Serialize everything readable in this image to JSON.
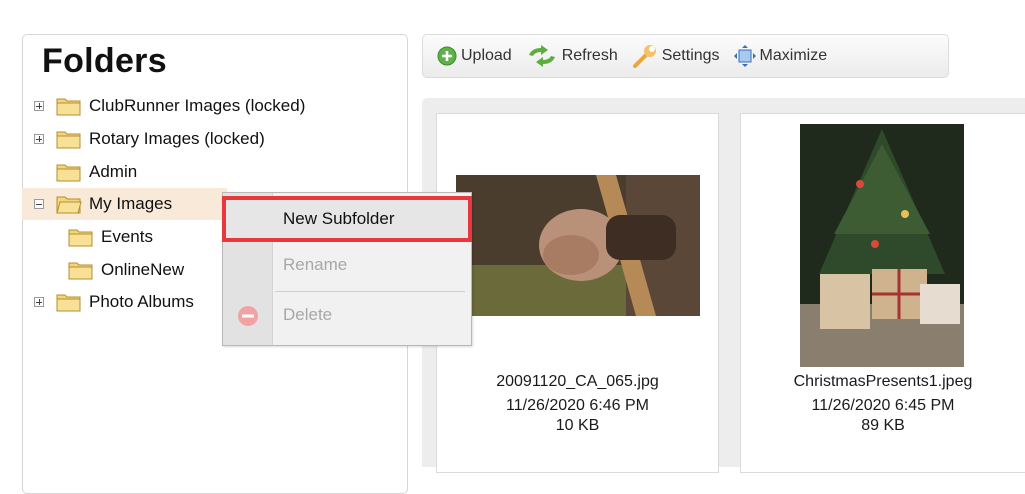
{
  "folders_panel": {
    "title": "Folders",
    "tree": [
      {
        "label": "ClubRunner Images (locked)"
      },
      {
        "label": "Rotary Images (locked)"
      },
      {
        "label": "Admin"
      },
      {
        "label": "My Images"
      },
      {
        "label": "Events"
      },
      {
        "label": "OnlineNew"
      },
      {
        "label": "Photo Albums"
      }
    ]
  },
  "toolbar": {
    "upload": "Upload",
    "refresh": "Refresh",
    "settings": "Settings",
    "maximize": "Maximize"
  },
  "files": [
    {
      "name": "20091120_CA_065.jpg",
      "date": "11/26/2020 6:46 PM",
      "size": "10 KB"
    },
    {
      "name": "ChristmasPresents1.jpeg",
      "date": "11/26/2020 6:45 PM",
      "size": "89 KB"
    }
  ],
  "context_menu": {
    "new_subfolder": "New Subfolder",
    "rename": "Rename",
    "delete": "Delete"
  },
  "colors": {
    "highlight": "#e8383d",
    "selected_row": "#f8e9d9",
    "folder": "#f3d57a"
  }
}
